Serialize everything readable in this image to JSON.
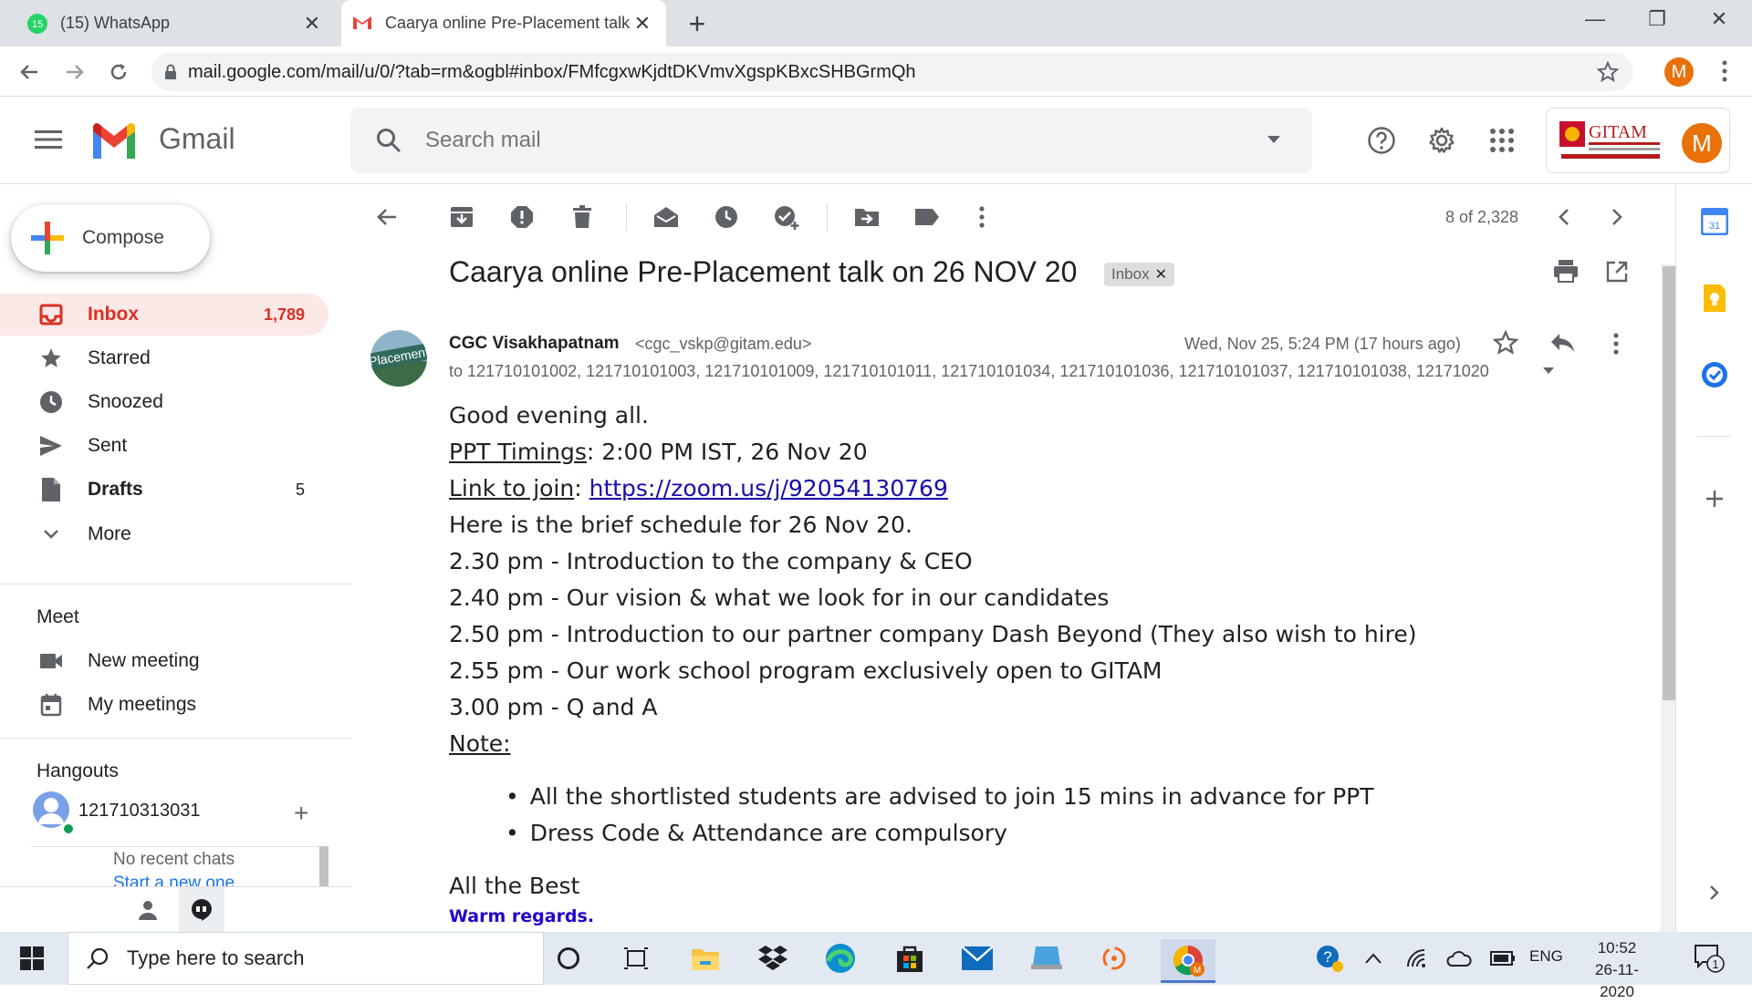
{
  "browser": {
    "tabs": [
      {
        "title": "(15) WhatsApp",
        "badge": "15"
      },
      {
        "title": "Caarya online Pre-Placement talk"
      }
    ],
    "url": "mail.google.com/mail/u/0/?tab=rm&ogbl#inbox/FMfcgxwKjdtDKVmvXgspKBxcSHBGrmQh",
    "profile_initial": "M"
  },
  "gmail": {
    "app_name": "Gmail",
    "search_placeholder": "Search mail",
    "account_initial": "M",
    "org_logo_text": "GITAM"
  },
  "sidebar": {
    "compose_label": "Compose",
    "items": [
      {
        "label": "Inbox",
        "count": "1,789",
        "icon": "inbox-icon"
      },
      {
        "label": "Starred",
        "count": "",
        "icon": "star-icon"
      },
      {
        "label": "Snoozed",
        "count": "",
        "icon": "clock-icon"
      },
      {
        "label": "Sent",
        "count": "",
        "icon": "send-icon"
      },
      {
        "label": "Drafts",
        "count": "5",
        "icon": "draft-icon"
      },
      {
        "label": "More",
        "count": "",
        "icon": "chevron-down-icon"
      }
    ],
    "meet": {
      "title": "Meet",
      "items": [
        {
          "label": "New meeting",
          "icon": "video-icon"
        },
        {
          "label": "My meetings",
          "icon": "calendar-icon"
        }
      ]
    },
    "hangouts": {
      "title": "Hangouts",
      "user": "121710313031",
      "no_chats": "No recent chats",
      "start_new": "Start a new one"
    }
  },
  "toolbar": {
    "count": "8 of 2,328"
  },
  "message": {
    "subject": "Caarya online Pre-Placement talk on 26 NOV 20",
    "label_chip": "Inbox",
    "sender_name": "CGC Visakhapatnam",
    "sender_email": "<cgc_vskp@gitam.edu>",
    "date": "Wed, Nov 25, 5:24 PM (17 hours ago)",
    "recipients": "to 121710101002, 121710101003, 121710101009, 121710101011, 121710101034, 121710101036, 121710101037, 121710101038, 12171020",
    "avatar_text": "Placement",
    "body": {
      "greeting": "Good evening all.",
      "ppt_label": "PPT Timings",
      "ppt_value": ": 2:00 PM IST, 26 Nov 20",
      "link_label": "Link to join",
      "link_sep": ": ",
      "link_url": "https://zoom.us/j/92054130769",
      "schedule_intro": "Here is the brief schedule for 26 Nov 20.",
      "schedule": [
        "2.30 pm - Introduction to the company & CEO",
        "2.40 pm - Our vision & what we look for in our candidates",
        "2.50 pm - Introduction to our partner company Dash Beyond (They also wish to hire)",
        "2.55 pm - Our work school program exclusively open to GITAM",
        "3.00 pm - Q and A"
      ],
      "note_label": "Note:",
      "notes": [
        "All the shortlisted students are advised to join 15 mins in advance for PPT",
        "Dress Code & Attendance are compulsory"
      ],
      "closing": "All the Best",
      "regards": "Warm regards."
    }
  },
  "taskbar": {
    "search_placeholder": "Type here to search",
    "language": "ENG",
    "time": "10:52",
    "date": "26-11-2020",
    "notification_count": "1"
  },
  "colors": {
    "gmail_red": "#d93025",
    "accent_blue": "#1a73e8",
    "inbox_highlight": "#fce8e6",
    "profile_orange": "#e8710a"
  }
}
